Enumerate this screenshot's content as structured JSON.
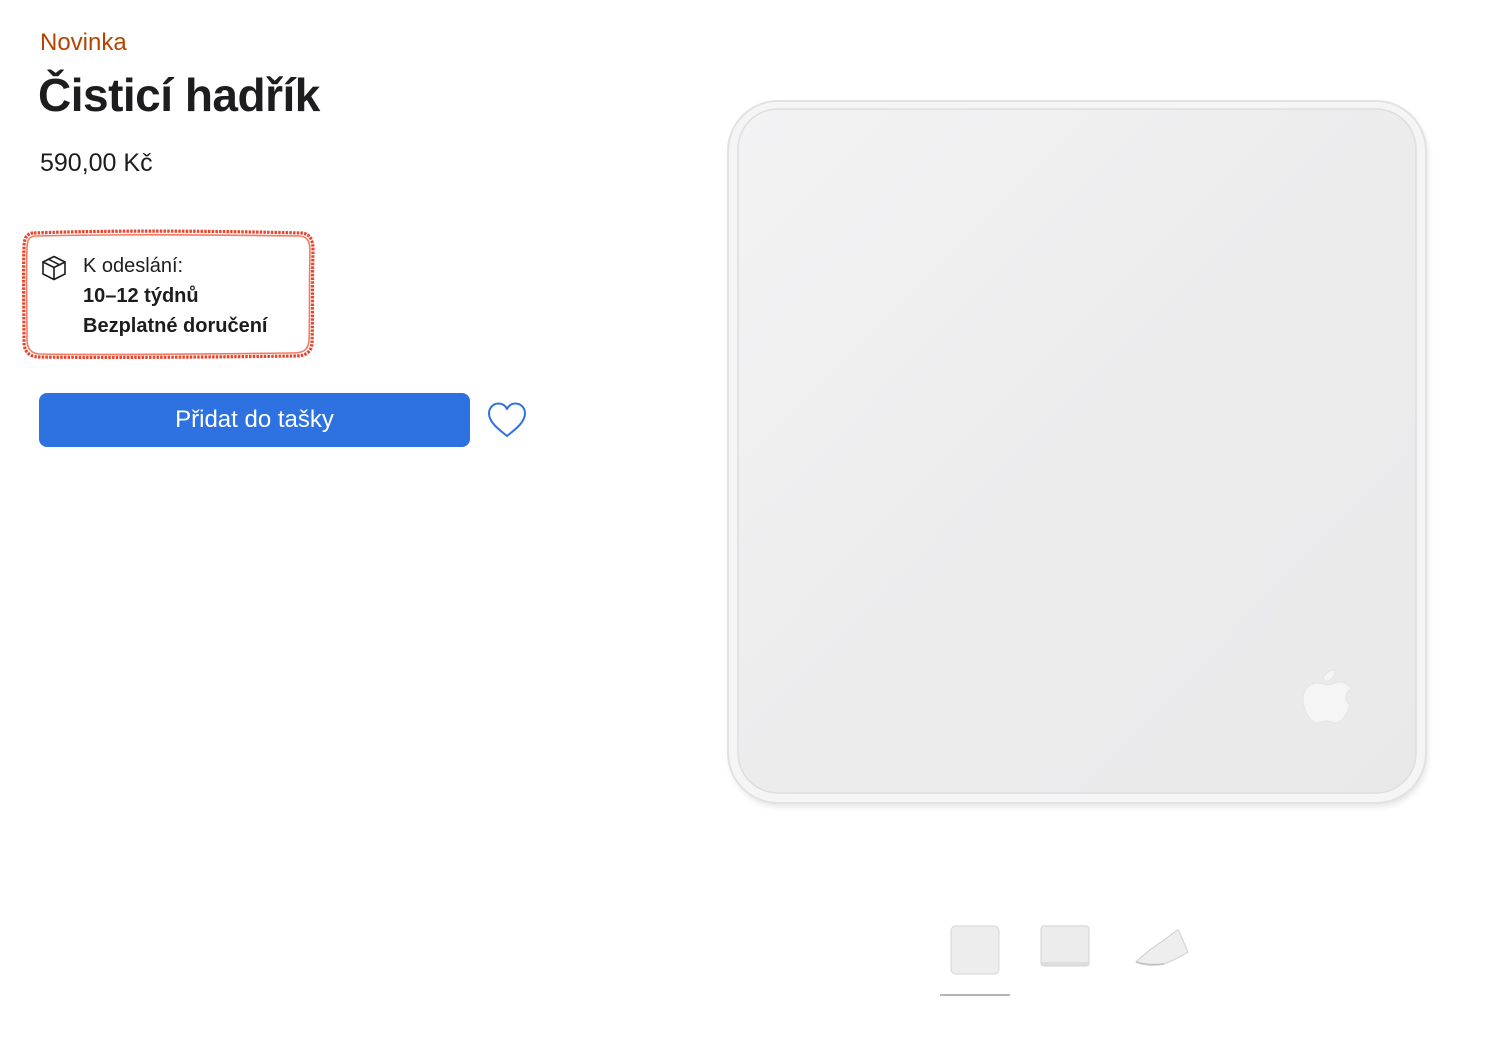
{
  "product": {
    "badge": "Novinka",
    "title": "Čisticí hadřík",
    "price": "590,00 Kč"
  },
  "shipping": {
    "icon": "package-box-icon",
    "label": "K odeslání:",
    "time": "10–12 týdnů",
    "delivery": "Bezplatné doručení"
  },
  "actions": {
    "add_to_bag_label": "Přidat do tašky",
    "favorite_icon": "heart-icon"
  },
  "gallery": {
    "selected_index": 0,
    "thumbnails": [
      {
        "name": "thumb-front"
      },
      {
        "name": "thumb-flat"
      },
      {
        "name": "thumb-folded"
      }
    ]
  },
  "colors": {
    "badge": "#b64400",
    "button": "#2e71e0",
    "highlight": "#e5462e"
  }
}
